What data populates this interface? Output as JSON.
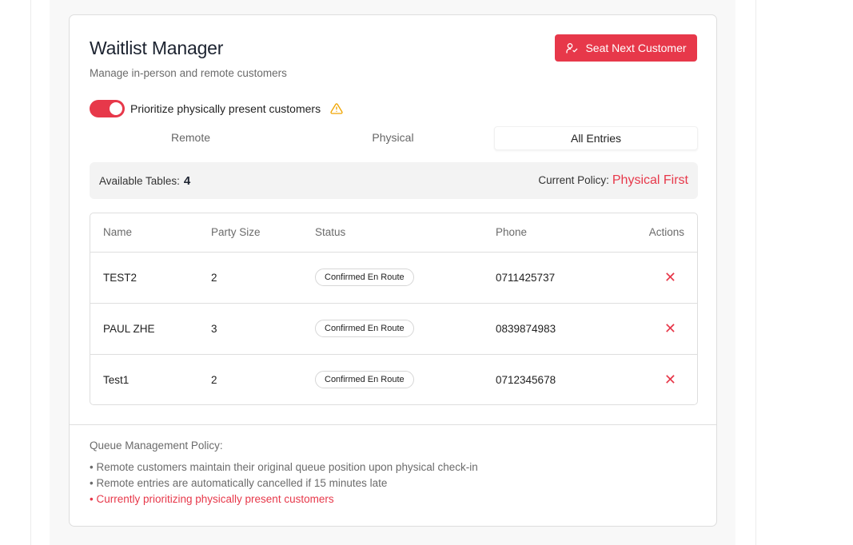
{
  "header": {
    "title": "Waitlist Manager",
    "subtitle": "Manage in-person and remote customers",
    "seat_button": "Seat Next Customer"
  },
  "toggle": {
    "label": "Prioritize physically present customers",
    "on": true
  },
  "tabs": [
    {
      "label": "Remote",
      "active": false
    },
    {
      "label": "Physical",
      "active": false
    },
    {
      "label": "All Entries",
      "active": true
    }
  ],
  "info": {
    "tables_label": "Available Tables:",
    "tables_count": "4",
    "policy_label": "Current Policy:",
    "policy_value": "Physical First"
  },
  "table": {
    "columns": [
      "Name",
      "Party Size",
      "Status",
      "Phone",
      "Actions"
    ],
    "rows": [
      {
        "name": "TEST2",
        "party": "2",
        "status": "Confirmed En Route",
        "phone": "0711425737"
      },
      {
        "name": "PAUL ZHE",
        "party": "3",
        "status": "Confirmed En Route",
        "phone": "0839874983"
      },
      {
        "name": "Test1",
        "party": "2",
        "status": "Confirmed En Route",
        "phone": "0712345678"
      }
    ],
    "delete_glyph": "✕"
  },
  "policy": {
    "title": "Queue Management Policy:",
    "items": [
      "• Remote customers maintain their original queue position upon physical check-in",
      "• Remote entries are automatically cancelled if 15 minutes late",
      "• Currently prioritizing physically present customers"
    ]
  },
  "colors": {
    "accent": "#e7384a",
    "warning": "#f0a500"
  }
}
